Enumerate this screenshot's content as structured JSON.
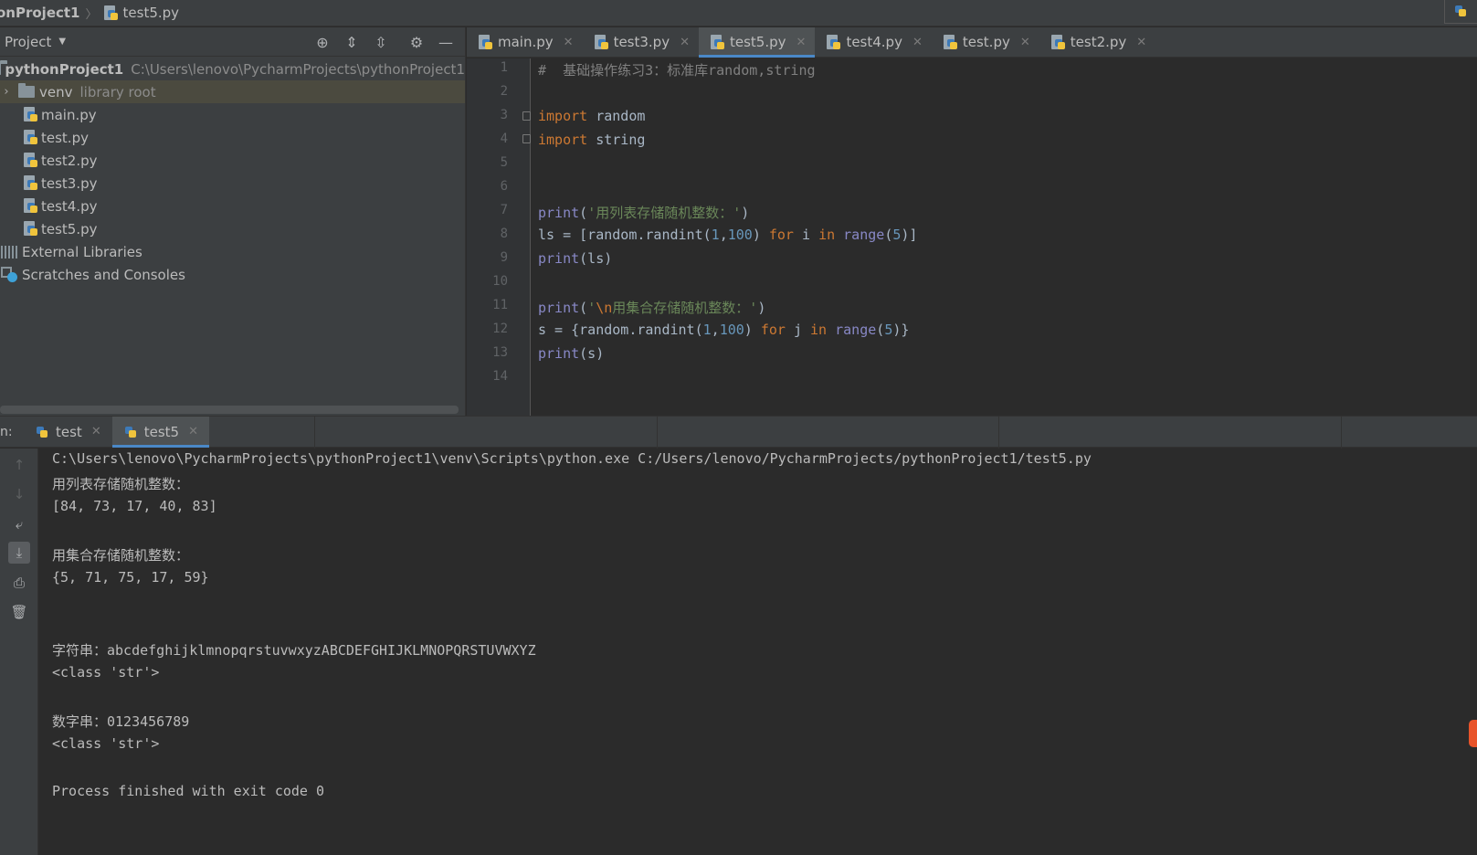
{
  "navbar": {
    "project_crumb": "onProject1",
    "file_crumb": "test5.py"
  },
  "project_panel": {
    "title": "Project",
    "tree": [
      {
        "label": "pythonProject1",
        "path": "C:\\Users\\lenovo\\PycharmProjects\\pythonProject1",
        "type": "project-root"
      },
      {
        "label": "venv",
        "hint": "library root",
        "type": "folder"
      },
      {
        "label": "main.py",
        "type": "py-file"
      },
      {
        "label": "test.py",
        "type": "py-file"
      },
      {
        "label": "test2.py",
        "type": "py-file"
      },
      {
        "label": "test3.py",
        "type": "py-file"
      },
      {
        "label": "test4.py",
        "type": "py-file"
      },
      {
        "label": "test5.py",
        "type": "py-file"
      },
      {
        "label": "External Libraries",
        "type": "libraries"
      },
      {
        "label": "Scratches and Consoles",
        "type": "scratches"
      }
    ]
  },
  "editor": {
    "tabs": [
      {
        "label": "main.py",
        "active": false
      },
      {
        "label": "test3.py",
        "active": false
      },
      {
        "label": "test5.py",
        "active": true
      },
      {
        "label": "test4.py",
        "active": false
      },
      {
        "label": "test.py",
        "active": false
      },
      {
        "label": "test2.py",
        "active": false
      }
    ],
    "line_numbers": [
      "1",
      "2",
      "3",
      "4",
      "5",
      "6",
      "7",
      "8",
      "9",
      "10",
      "11",
      "12",
      "13",
      "14"
    ],
    "code": {
      "l1_comment": "#  基础操作练习3：标准库random,string",
      "l3_import": "import",
      "l3_module": " random",
      "l4_import": "import",
      "l4_module": " string",
      "l7_print": "print",
      "l7_open": "(",
      "l7_str": "'用列表存储随机整数：'",
      "l7_close": ")",
      "l8_a": "ls = [random.randint(",
      "l8_n1": "1",
      "l8_comma": ",",
      "l8_n2": "100",
      "l8_b": ") ",
      "l8_for": "for",
      "l8_c": " i ",
      "l8_in": "in",
      "l8_d": " ",
      "l8_range": "range",
      "l8_e": "(",
      "l8_n3": "5",
      "l8_f": ")]",
      "l9_print": "print",
      "l9_rest": "(ls)",
      "l11_print": "print",
      "l11_open": "(",
      "l11_q": "'",
      "l11_esc": "\\n",
      "l11_str": "用集合存储随机整数：'",
      "l11_close": ")",
      "l12_a": "s = {random.randint(",
      "l12_n1": "1",
      "l12_comma": ",",
      "l12_n2": "100",
      "l12_b": ") ",
      "l12_for": "for",
      "l12_c": " j ",
      "l12_in": "in",
      "l12_d": " ",
      "l12_range": "range",
      "l12_e": "(",
      "l12_n3": "5",
      "l12_f": ")}",
      "l13_print": "print",
      "l13_rest": "(s)"
    }
  },
  "run": {
    "label": "n:",
    "tabs": [
      {
        "label": "test",
        "active": false
      },
      {
        "label": "test5",
        "active": true
      }
    ],
    "output": [
      "C:\\Users\\lenovo\\PycharmProjects\\pythonProject1\\venv\\Scripts\\python.exe C:/Users/lenovo/PycharmProjects/pythonProject1/test5.py",
      "用列表存储随机整数：",
      "[84, 73, 17, 40, 83]",
      "",
      "用集合存储随机整数：",
      "{5, 71, 75, 17, 59}",
      "",
      "",
      "字符串：abcdefghijklmnopqrstuvwxyzABCDEFGHIJKLMNOPQRSTUVWXYZ",
      "<class 'str'>",
      "",
      "数字串：0123456789",
      "<class 'str'>",
      "",
      "Process finished with exit code 0"
    ]
  },
  "colors": {
    "keyword": "#cc7832",
    "builtin": "#8888c6",
    "string": "#6a8759",
    "number": "#6897bb",
    "comment": "#808080",
    "accent": "#4a88c7"
  }
}
